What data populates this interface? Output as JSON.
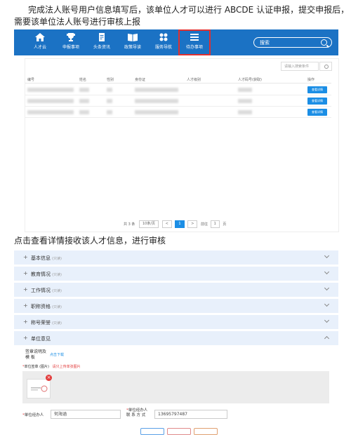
{
  "intro": {
    "line1": "完成法人账号用户信息填写后，该单位人才可以进行 ABCDE 认证申报，提交申报后，",
    "line2": "需要该单位法人账号进行审核上报"
  },
  "nav": {
    "items": [
      {
        "label": "人才云",
        "icon": "home-icon"
      },
      {
        "label": "申报事项",
        "icon": "trophy-icon"
      },
      {
        "label": "头条资讯",
        "icon": "document-icon"
      },
      {
        "label": "政策导读",
        "icon": "book-icon"
      },
      {
        "label": "服务导航",
        "icon": "grid-icon"
      },
      {
        "label": "待办事项",
        "icon": "list-icon"
      }
    ],
    "search_placeholder": "搜索",
    "active_color": "#e03030",
    "bar_color": "#1b72c4"
  },
  "table": {
    "search_placeholder": "请输入搜索条件",
    "columns": [
      "编号",
      "姓名",
      "性别",
      "身份证",
      "人才级别",
      "人才码号(获取)",
      "操作"
    ],
    "rows": [
      {
        "action": "查看详情"
      },
      {
        "action": "查看详情"
      },
      {
        "action": "查看详情"
      }
    ],
    "pagination": {
      "total": "共 3 条",
      "page_size": "10条/页",
      "prev": "<",
      "current": "1",
      "next": ">",
      "goto_label": "前往",
      "goto_value": "1",
      "page_unit": "页"
    }
  },
  "section2_text": "点击查看详情接收该人才信息，进行审核",
  "accordion": [
    {
      "title": "基本信息",
      "note": "(只读)"
    },
    {
      "title": "教育情况",
      "note": "(只读)"
    },
    {
      "title": "工作情况",
      "note": "(只读)"
    },
    {
      "title": "职称资格",
      "note": "(只读)"
    },
    {
      "title": "称号荣誉",
      "note": "(只读)"
    },
    {
      "title": "单位意见",
      "note": ""
    }
  ],
  "unit_opinion": {
    "template_label_1": "签章说明及",
    "template_label_2": "模     板",
    "download_link": "点击下载",
    "seal_label": "单位签章 (图片)",
    "seal_hint": "请只上传单张图片",
    "contact_label": "单位经办人",
    "contact_value": "何海涵",
    "phone_label_1": "单位经办人",
    "phone_label_2": "联 系 方 式",
    "phone_value": "13695797487"
  }
}
